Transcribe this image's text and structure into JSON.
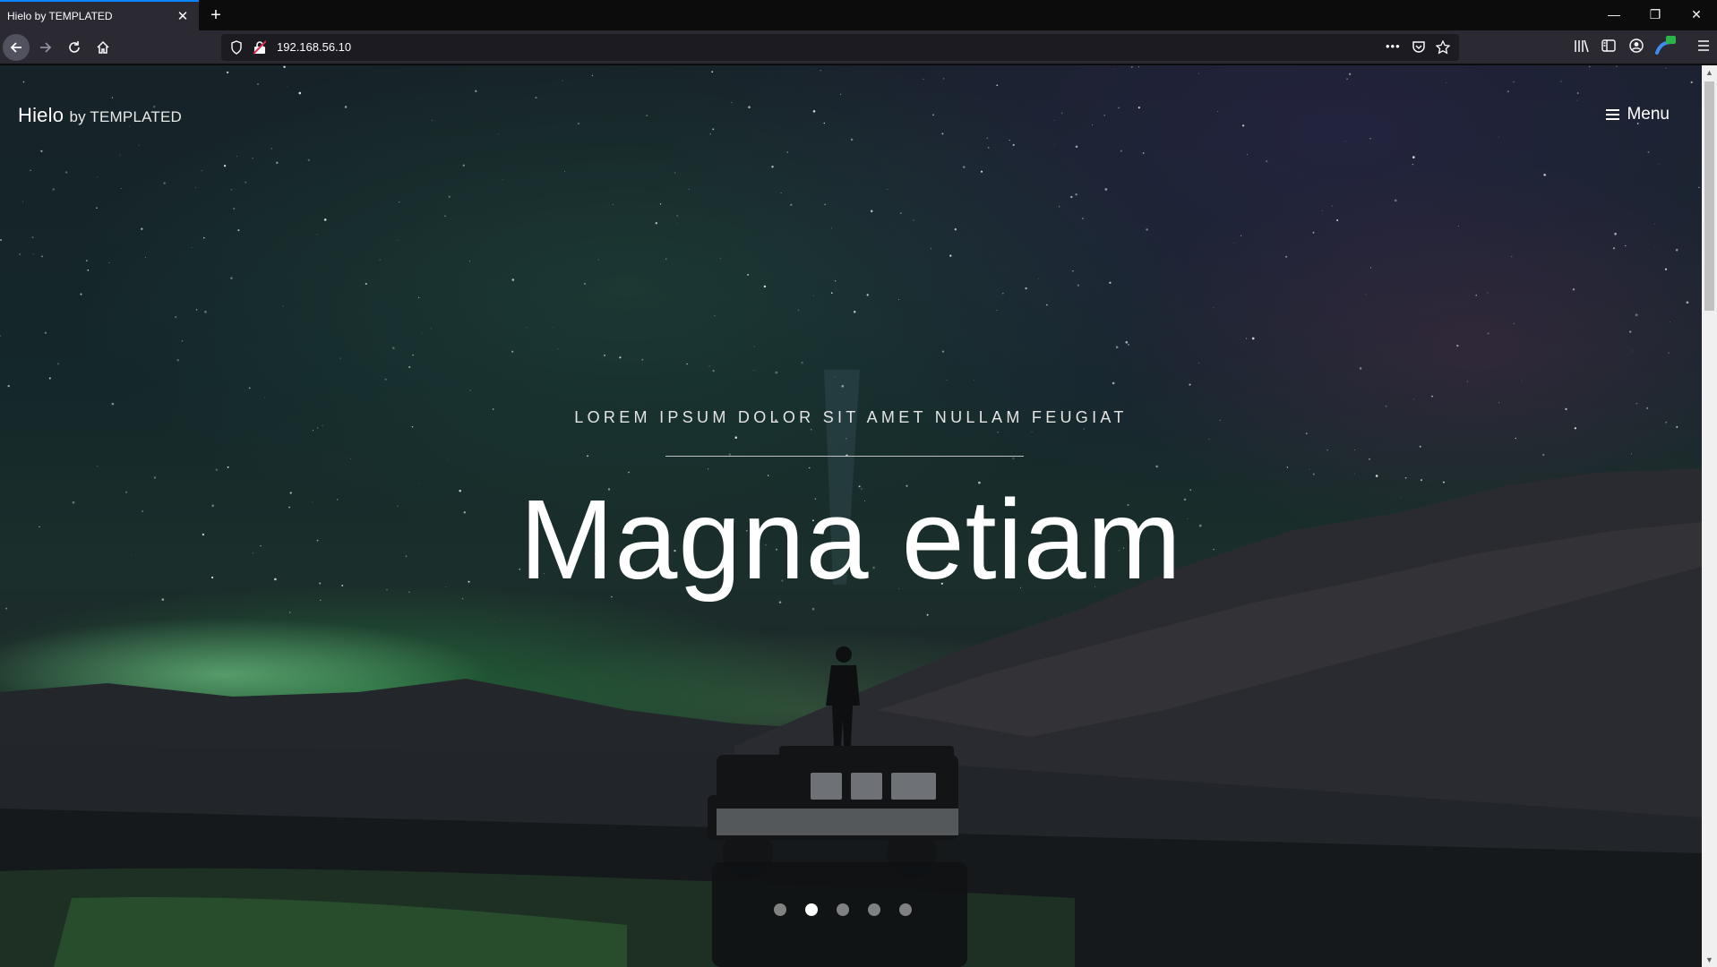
{
  "browser": {
    "tab_title": "Hielo by TEMPLATED",
    "tab_close": "✕",
    "new_tab": "+",
    "url": "192.168.56.10",
    "page_actions": "•••",
    "window": {
      "minimize": "—",
      "restore": "❐",
      "close": "✕"
    }
  },
  "site": {
    "logo_main": "Hielo",
    "logo_sub": "by TEMPLATED",
    "menu_label": "Menu"
  },
  "hero": {
    "subtitle": "LOREM IPSUM DOLOR SIT AMET NULLAM FEUGIAT",
    "title": "Magna etiam",
    "slides_count": 5,
    "active_slide": 2
  },
  "scrollbar": {
    "up": "▲",
    "down": "▼"
  }
}
